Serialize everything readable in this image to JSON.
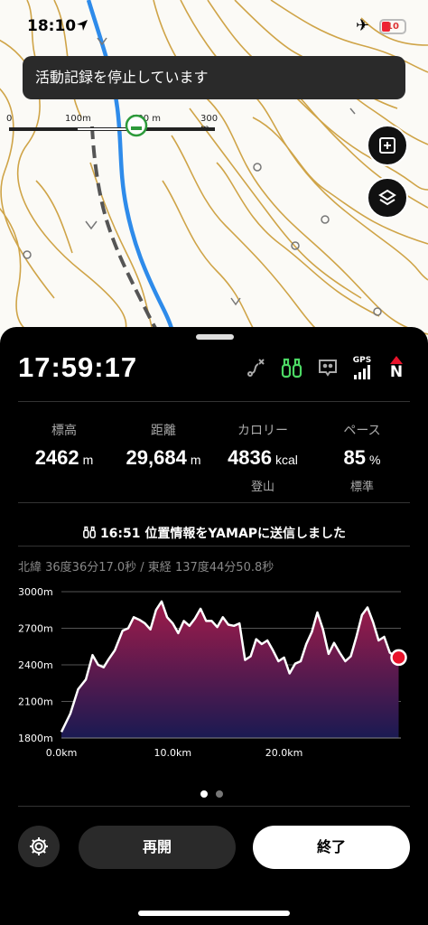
{
  "status_bar": {
    "time": "18:10",
    "battery": "10",
    "location_icon": "location-arrow-icon",
    "airplane_icon": "airplane-icon"
  },
  "toast": {
    "message": "活動記録を停止しています"
  },
  "map": {
    "scale_labels": [
      "0",
      "100m",
      "200 m",
      "300 m"
    ],
    "layers_icon": "layers-icon",
    "expand_icon": "expand-icon",
    "colors": {
      "contour": "#c8962a",
      "route": "#2e8bea",
      "trail": "#555555",
      "background": "#fbfaf6"
    }
  },
  "panel": {
    "elapsed_time": "17:59:17",
    "tools": [
      "route-icon",
      "binoculars-icon",
      "chat-icon",
      "gps-signal-icon",
      "compass-north-icon"
    ],
    "gps_label": "GPS",
    "compass_label": "N",
    "stats": [
      {
        "label": "標高",
        "value": "2462",
        "unit": "m",
        "sub": ""
      },
      {
        "label": "距離",
        "value": "29,684",
        "unit": "m",
        "sub": ""
      },
      {
        "label": "カロリー",
        "value": "4836",
        "unit": "kcal",
        "sub": "登山"
      },
      {
        "label": "ペース",
        "value": "85",
        "unit": "%",
        "sub": "標準"
      }
    ],
    "sent_message": "16:51 位置情報をYAMAPに送信しました",
    "coordinates": "北緯 36度36分17.0秒 / 東経 137度44分50.8秒",
    "page_indicator": {
      "count": 2,
      "active": 0
    },
    "buttons": {
      "resume": "再開",
      "finish": "終了"
    }
  },
  "chart_data": {
    "type": "area",
    "title": "",
    "xlabel": "",
    "ylabel": "",
    "x_ticks": [
      "0.0km",
      "10.0km",
      "20.0km"
    ],
    "y_ticks": [
      "3000m",
      "2700m",
      "2400m",
      "2100m",
      "1800m"
    ],
    "xlim": [
      0,
      30.5
    ],
    "ylim": [
      1800,
      3000
    ],
    "x": [
      0,
      0.8,
      1.5,
      2.2,
      2.8,
      3.3,
      3.8,
      4.2,
      4.8,
      5.5,
      6.0,
      6.5,
      7.0,
      7.5,
      8.0,
      8.5,
      9.0,
      9.5,
      10.0,
      10.5,
      11.0,
      11.5,
      12.0,
      12.5,
      13.0,
      13.5,
      14.0,
      14.5,
      15.0,
      15.5,
      16.0,
      16.5,
      17.0,
      17.5,
      18.0,
      18.5,
      19.0,
      19.5,
      20.0,
      20.5,
      21.0,
      21.5,
      22.0,
      22.5,
      23.0,
      23.5,
      24.0,
      24.5,
      25.0,
      25.5,
      26.0,
      26.5,
      27.0,
      27.5,
      28.0,
      28.5,
      29.0,
      29.5,
      30.0,
      30.3
    ],
    "y": [
      1850,
      2000,
      2200,
      2280,
      2480,
      2400,
      2380,
      2440,
      2520,
      2680,
      2700,
      2790,
      2770,
      2740,
      2690,
      2850,
      2920,
      2790,
      2740,
      2660,
      2760,
      2720,
      2780,
      2860,
      2760,
      2760,
      2710,
      2790,
      2730,
      2720,
      2740,
      2440,
      2470,
      2610,
      2570,
      2600,
      2520,
      2430,
      2460,
      2330,
      2410,
      2430,
      2570,
      2670,
      2830,
      2690,
      2490,
      2580,
      2500,
      2430,
      2470,
      2630,
      2810,
      2870,
      2750,
      2600,
      2630,
      2500,
      2470,
      2460
    ],
    "current_point": {
      "x": 30.3,
      "y": 2460
    },
    "colors": {
      "top": "#a01b4a",
      "bottom": "#1a1a52",
      "line": "#ffffff",
      "marker": "#e8132b"
    }
  }
}
